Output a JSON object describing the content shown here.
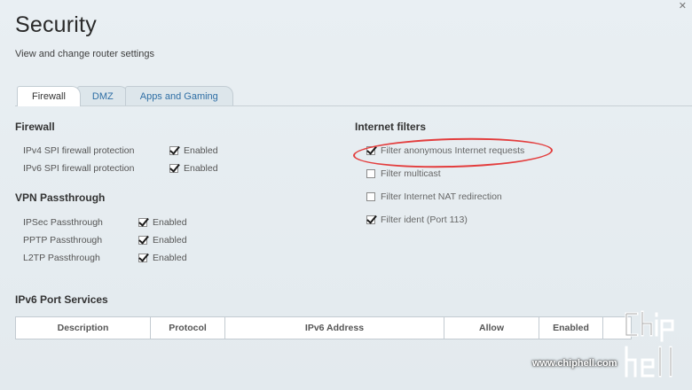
{
  "page": {
    "title": "Security",
    "subtitle": "View and change router settings"
  },
  "tabs": [
    {
      "label": "Firewall",
      "active": true
    },
    {
      "label": "DMZ",
      "active": false
    },
    {
      "label": "Apps and Gaming",
      "active": false
    }
  ],
  "firewall": {
    "title": "Firewall",
    "rows": [
      {
        "label": "IPv4 SPI firewall protection",
        "value": "Enabled",
        "checked": true
      },
      {
        "label": "IPv6 SPI firewall protection",
        "value": "Enabled",
        "checked": true
      }
    ]
  },
  "vpn": {
    "title": "VPN Passthrough",
    "rows": [
      {
        "label": "IPSec Passthrough",
        "value": "Enabled",
        "checked": true
      },
      {
        "label": "PPTP Passthrough",
        "value": "Enabled",
        "checked": true
      },
      {
        "label": "L2TP Passthrough",
        "value": "Enabled",
        "checked": true
      }
    ]
  },
  "internet_filters": {
    "title": "Internet filters",
    "items": [
      {
        "label": "Filter anonymous Internet requests",
        "checked": true
      },
      {
        "label": "Filter multicast",
        "checked": false
      },
      {
        "label": "Filter Internet NAT redirection",
        "checked": false
      },
      {
        "label": "Filter ident (Port 113)",
        "checked": true
      }
    ]
  },
  "ipv6_port_services": {
    "title": "IPv6 Port Services",
    "columns": [
      "Description",
      "Protocol",
      "IPv6 Address",
      "Allow",
      "Enabled"
    ]
  },
  "watermark": {
    "url": "www.chiphell.com",
    "logo_text": "chip hell"
  },
  "colors": {
    "accent": "#2f6fa5",
    "annotation": "#e33d3d"
  }
}
